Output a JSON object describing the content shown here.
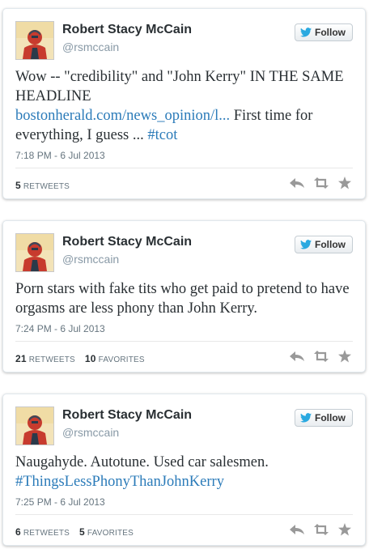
{
  "tweets": [
    {
      "author": "Robert Stacy McCain",
      "handle": "@rsmccain",
      "follow_label": "Follow",
      "text_parts": [
        "Wow -- \"credibility\" and \"John Kerry\" IN THE SAME HEADLINE"
      ],
      "link": "bostonherald.com/news_opinion/l...",
      "text_after_link": " First time for everything, I guess ... ",
      "hashtag": "#tcot",
      "date": "7:18 PM - 6 Jul 2013",
      "retweets_count": "5",
      "retweets_label": "RETWEETS",
      "favorites_count": "",
      "favorites_label": ""
    },
    {
      "author": "Robert Stacy McCain",
      "handle": "@rsmccain",
      "follow_label": "Follow",
      "text": "Porn stars with fake tits who get paid to pretend to have orgasms are less phony than John Kerry.",
      "date": "7:24 PM - 6 Jul 2013",
      "retweets_count": "21",
      "retweets_label": "RETWEETS",
      "favorites_count": "10",
      "favorites_label": "FAVORITES"
    },
    {
      "author": "Robert Stacy McCain",
      "handle": "@rsmccain",
      "follow_label": "Follow",
      "text": "Naugahyde. Autotune. Used car salesmen.",
      "hashtag": "#ThingsLessPhonyThanJohnKerry",
      "date": "7:25 PM - 6 Jul 2013",
      "retweets_count": "6",
      "retweets_label": "RETWEETS",
      "favorites_count": "5",
      "favorites_label": "FAVORITES"
    }
  ],
  "icons": {
    "follow": "twitter-bird-icon",
    "reply": "reply-icon",
    "retweet": "retweet-icon",
    "favorite": "star-icon"
  },
  "colors": {
    "link": "#2b7bb9",
    "bird": "#2aa9e0",
    "action_icon": "#999999"
  }
}
